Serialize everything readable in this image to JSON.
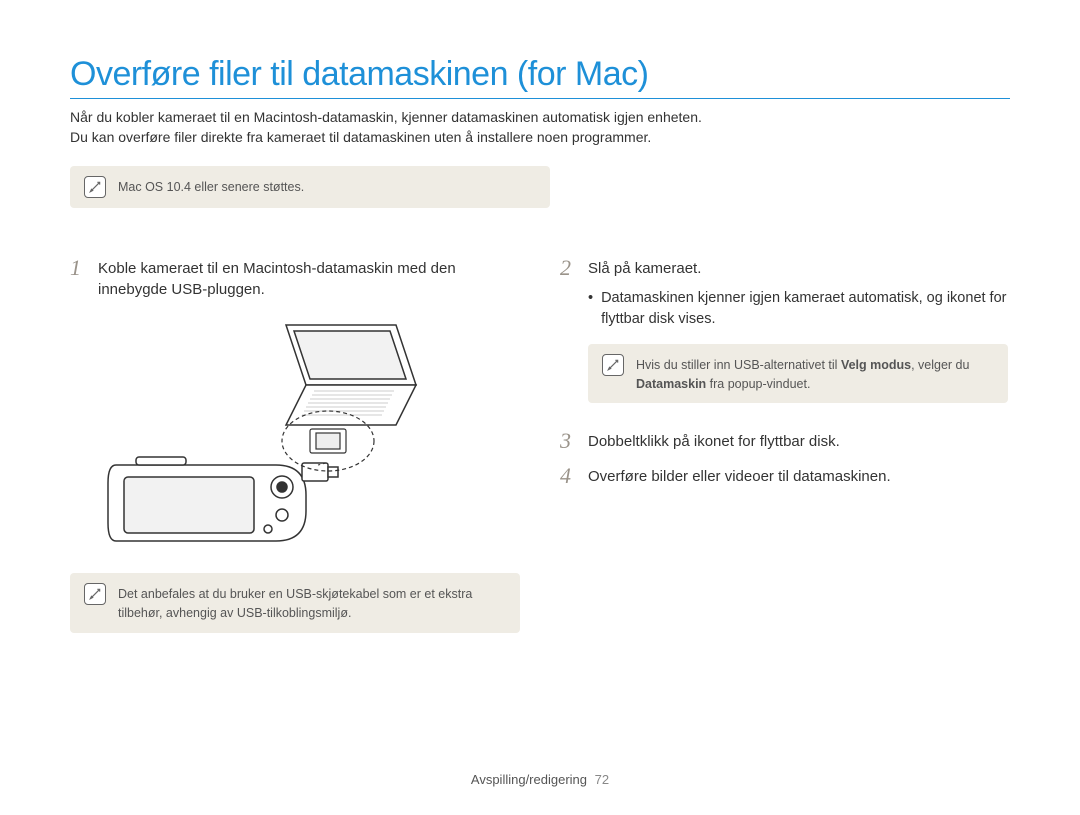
{
  "title": "Overføre filer til datamaskinen (for Mac)",
  "intro_line1": "Når du kobler kameraet til en Macintosh-datamaskin, kjenner datamaskinen automatisk igjen enheten.",
  "intro_line2": "Du kan overføre filer direkte fra kameraet til datamaskinen uten å installere noen programmer.",
  "note_top": "Mac OS 10.4 eller senere støttes.",
  "steps": {
    "s1": {
      "num": "1",
      "text": "Koble kameraet til en Macintosh-datamaskin med den innebygde USB-pluggen."
    },
    "s2": {
      "num": "2",
      "text": "Slå på kameraet."
    },
    "s2_sub": "Datamaskinen kjenner igjen kameraet automatisk, og ikonet for flyttbar disk vises.",
    "s3": {
      "num": "3",
      "text": "Dobbeltklikk på ikonet for flyttbar disk."
    },
    "s4": {
      "num": "4",
      "text": "Overføre bilder eller videoer til datamaskinen."
    }
  },
  "note_left": "Det anbefales at du bruker en USB-skjøtekabel som er et ekstra tilbehør, avhengig av USB-tilkoblingsmiljø.",
  "note_right_pre": "Hvis du stiller inn USB-alternativet til ",
  "note_right_bold1": "Velg modus",
  "note_right_mid": ", velger du ",
  "note_right_bold2": "Datamaskin",
  "note_right_post": " fra popup-vinduet.",
  "footer_label": "Avspilling/redigering",
  "footer_page": "72"
}
